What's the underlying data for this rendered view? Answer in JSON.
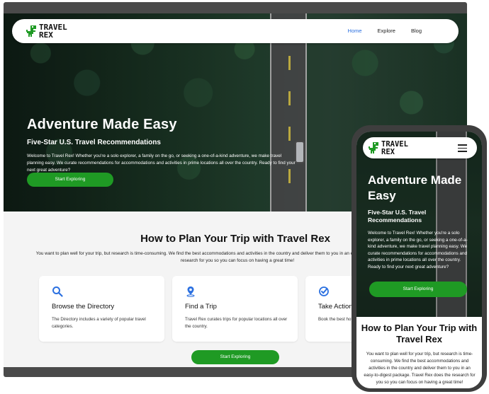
{
  "colors": {
    "accent_green": "#1f9a24",
    "nav_active": "#2b70e0",
    "frame": "#4a4a4a"
  },
  "brand": {
    "line1": "TRAVEL",
    "line2": "REX",
    "logo_icon": "dinosaur-icon"
  },
  "nav": {
    "items": [
      {
        "label": "Home",
        "active": true
      },
      {
        "label": "Explore",
        "active": false
      },
      {
        "label": "Blog",
        "active": false
      }
    ]
  },
  "hero": {
    "title": "Adventure Made Easy",
    "subtitle": "Five-Star U.S. Travel Recommendations",
    "body": "Welcome to Travel Rex! Whether you're a solo explorer, a family on the go, or seeking a one-of-a-kind adventure, we make travel planning easy. We curate recommendations for accommodations and activities in prime locations all over the country. Ready to find your next great adventure?",
    "cta": "Start Exploring"
  },
  "plan": {
    "title": "How to Plan Your Trip with Travel Rex",
    "body": "You want to plan well for your trip, but research is time-consuming. We find the best accommodations and activities in the country and deliver them to you in an easy-to-digest package. Travel Rex does the research for you so you can focus on having a great time!",
    "cards": [
      {
        "icon": "search-icon",
        "title": "Browse the Directory",
        "body": "The Directory includes a variety of popular travel categories."
      },
      {
        "icon": "map-pin-icon",
        "title": "Find a Trip",
        "body": "Travel Rex curates trips for popular locations all over the country."
      },
      {
        "icon": "check-badge-icon",
        "title": "Take Action",
        "body": "Book the best hotels and activities for your trip."
      }
    ],
    "cta": "Start Exploring"
  },
  "mobile": {
    "menu_icon": "hamburger-menu-icon",
    "hero_title": "Adventure Made Easy",
    "hero_subtitle": "Five-Star U.S. Travel Recommendations",
    "hero_body": "Welcome to Travel Rex! Whether you're a solo explorer, a family on the go, or seeking a one-of-a-kind adventure, we make travel planning easy. We curate recommendations for accommodations and activities in prime locations all over the country. Ready to find your next great adventure?",
    "cta": "Start Exploring",
    "plan_title": "How to Plan Your Trip with Travel Rex",
    "plan_body": "You want to plan well for your trip, but research is time-consuming. We find the best accommodations and activities in the country and deliver them to you in an easy-to-digest package. Travel Rex does the research for you so you can focus on having a great time!"
  }
}
